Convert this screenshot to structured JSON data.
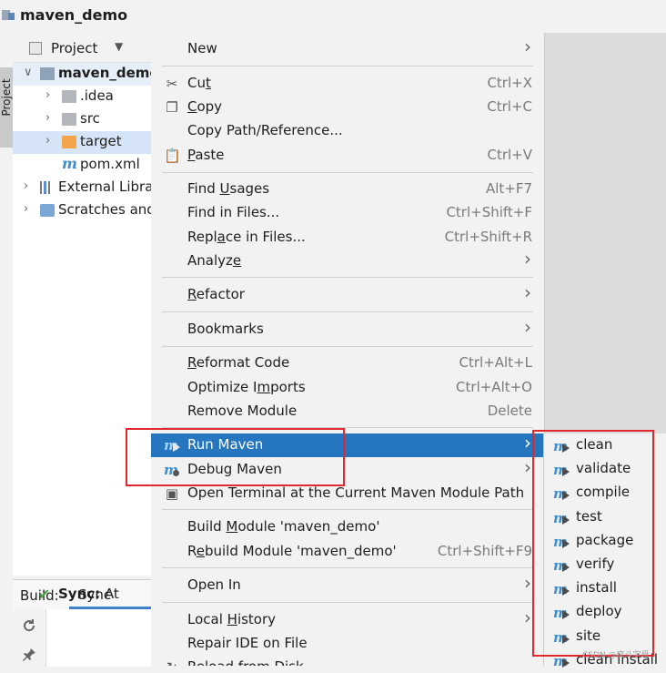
{
  "title_bar": {
    "title": "maven_demo"
  },
  "side_strip": {
    "tab_label": "Project"
  },
  "project_panel": {
    "header": {
      "label": "Project",
      "caret": "▼"
    },
    "tree": [
      {
        "label": "maven_demo",
        "kind": "module",
        "expand": "∨",
        "indent": 0,
        "selected": true,
        "bold": true
      },
      {
        "label": ".idea",
        "kind": "folder",
        "expand": "›",
        "indent": 1
      },
      {
        "label": "src",
        "kind": "folder",
        "expand": "›",
        "indent": 1
      },
      {
        "label": "target",
        "kind": "folder-orange",
        "expand": "›",
        "indent": 1,
        "selected": true
      },
      {
        "label": "pom.xml",
        "kind": "pom",
        "expand": "",
        "indent": 1
      },
      {
        "label": "External Libra",
        "kind": "libraries",
        "expand": "›",
        "indent": 0
      },
      {
        "label": "Scratches and",
        "kind": "scratches",
        "expand": "›",
        "indent": 0
      }
    ]
  },
  "build_panel": {
    "label": "Build:",
    "tab": "Sync",
    "status_check": "✔",
    "status": "Sync:",
    "status_tail": "At"
  },
  "context_menu": {
    "items": [
      {
        "label": "New",
        "submenu": true
      },
      {
        "sep": true
      },
      {
        "label": "Cut",
        "ul": 2,
        "shortcut": "Ctrl+X",
        "icon": "cut"
      },
      {
        "label": "Copy",
        "ul": 0,
        "shortcut": "Ctrl+C",
        "icon": "copy"
      },
      {
        "label": "Copy Path/Reference..."
      },
      {
        "label": "Paste",
        "ul": 0,
        "shortcut": "Ctrl+V",
        "icon": "paste"
      },
      {
        "sep": true
      },
      {
        "label": "Find Usages",
        "ul": 5,
        "shortcut": "Alt+F7"
      },
      {
        "label": "Find in Files...",
        "shortcut": "Ctrl+Shift+F"
      },
      {
        "label": "Replace in Files...",
        "ul": 4,
        "shortcut": "Ctrl+Shift+R"
      },
      {
        "label": "Analyze",
        "ul": 6,
        "submenu": true
      },
      {
        "sep": true
      },
      {
        "label": "Refactor",
        "ul": 0,
        "submenu": true
      },
      {
        "sep": true
      },
      {
        "label": "Bookmarks",
        "submenu": true
      },
      {
        "sep": true
      },
      {
        "label": "Reformat Code",
        "ul": 0,
        "shortcut": "Ctrl+Alt+L"
      },
      {
        "label": "Optimize Imports",
        "ul": 10,
        "shortcut": "Ctrl+Alt+O"
      },
      {
        "label": "Remove Module",
        "shortcut": "Delete"
      },
      {
        "sep": true
      },
      {
        "label": "Run Maven",
        "submenu": true,
        "icon": "maven-run",
        "highlighted": true
      },
      {
        "label": "Debug Maven",
        "submenu": true,
        "icon": "maven-debug"
      },
      {
        "label": "Open Terminal at the Current Maven Module Path",
        "icon": "terminal"
      },
      {
        "sep": true
      },
      {
        "label": "Build Module 'maven_demo'",
        "ul": 6
      },
      {
        "label": "Rebuild Module 'maven_demo'",
        "ul": 1,
        "shortcut": "Ctrl+Shift+F9"
      },
      {
        "sep": true
      },
      {
        "label": "Open In",
        "submenu": true
      },
      {
        "sep": true
      },
      {
        "label": "Local History",
        "ul": 6,
        "submenu": true
      },
      {
        "label": "Repair IDE on File"
      },
      {
        "label": "Reload from Disk",
        "icon": "reload"
      }
    ]
  },
  "maven_submenu": {
    "items": [
      "clean",
      "validate",
      "compile",
      "test",
      "package",
      "verify",
      "install",
      "deploy",
      "site",
      "clean install"
    ]
  },
  "watermark": "CSDN @疯斗字母",
  "colors": {
    "highlight": "#2675bf",
    "annotation_red": "#e0282e",
    "maven_blue": "#3d8fd1",
    "folder_orange": "#f3a549"
  }
}
